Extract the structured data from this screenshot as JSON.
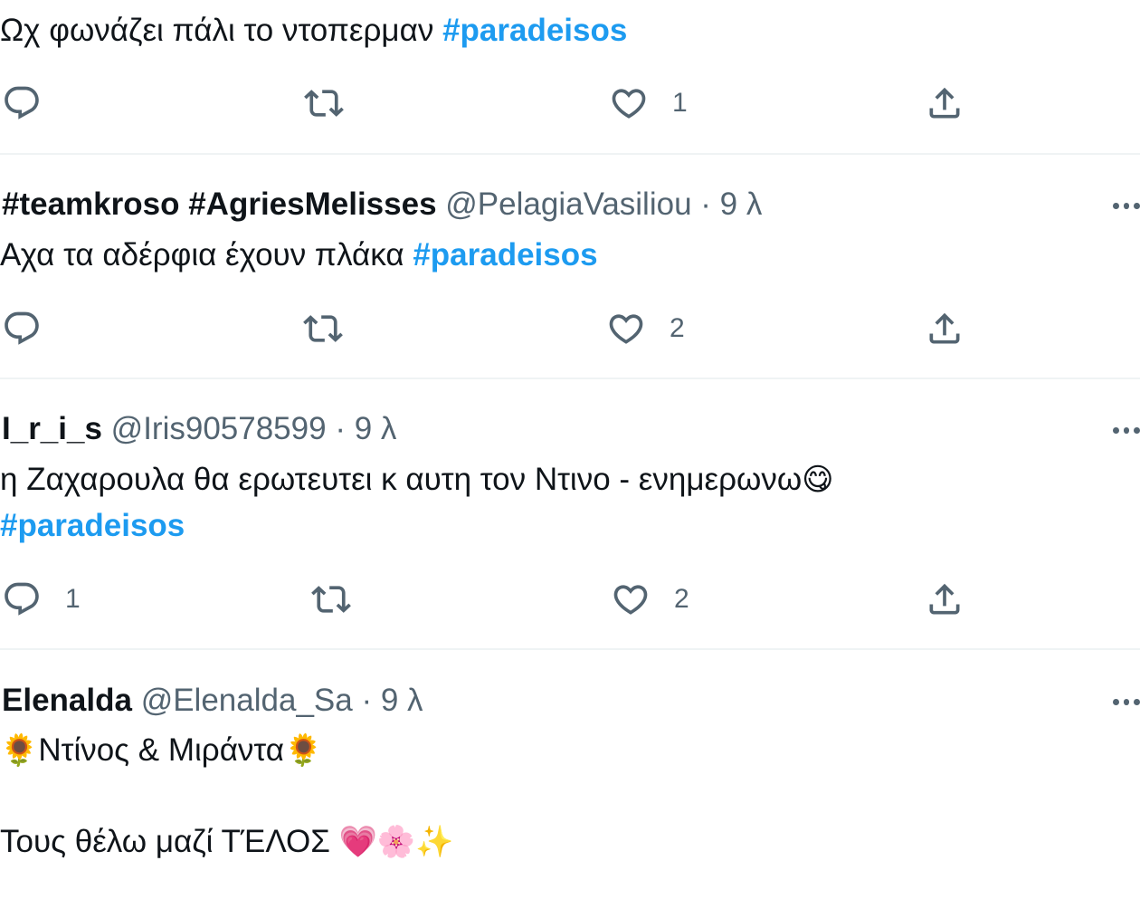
{
  "tweets": [
    {
      "text": "Ωχ φωνάζει πάλι το ντοπερμαν",
      "hashtag": "#paradeisos",
      "reply_count": "",
      "like_count": "1"
    },
    {
      "name": "#teamkroso #AgriesMelisses",
      "handle": "@PelagiaVasiliou",
      "separator": "·",
      "time": "9 λ",
      "text": "Αχα τα αδέρφια έχουν πλάκα ",
      "hashtag": "#paradeisos",
      "reply_count": "",
      "like_count": "2"
    },
    {
      "name": "I_r_i_s",
      "handle": "@Iris90578599",
      "separator": "·",
      "time": "9 λ",
      "text": "η Ζαχαρουλα θα ερωτευτει κ αυτη τον Ντινο - ενημερωνω",
      "emoji": "😋",
      "hashtag": "#paradeisos",
      "reply_count": "1",
      "like_count": "2"
    },
    {
      "name": "Elenalda",
      "handle": "@Elenalda_Sa",
      "separator": "·",
      "time": "9 λ",
      "emoji_left": "🌻",
      "text": "Ντίνος & Μιράντα",
      "emoji_right": "🌻",
      "text2": "Τους θέλω μαζί ΤΈΛΟΣ",
      "emoji_end": "💗🌸✨"
    }
  ],
  "icons": {
    "reply": "reply-bubble-icon",
    "retweet": "retweet-icon",
    "like": "heart-icon",
    "share": "share-icon",
    "more": "more-dots-icon"
  },
  "colors": {
    "text": "#0f1419",
    "secondary": "#536471",
    "hashtag": "#1d9bf0",
    "divider": "#eff3f4"
  }
}
